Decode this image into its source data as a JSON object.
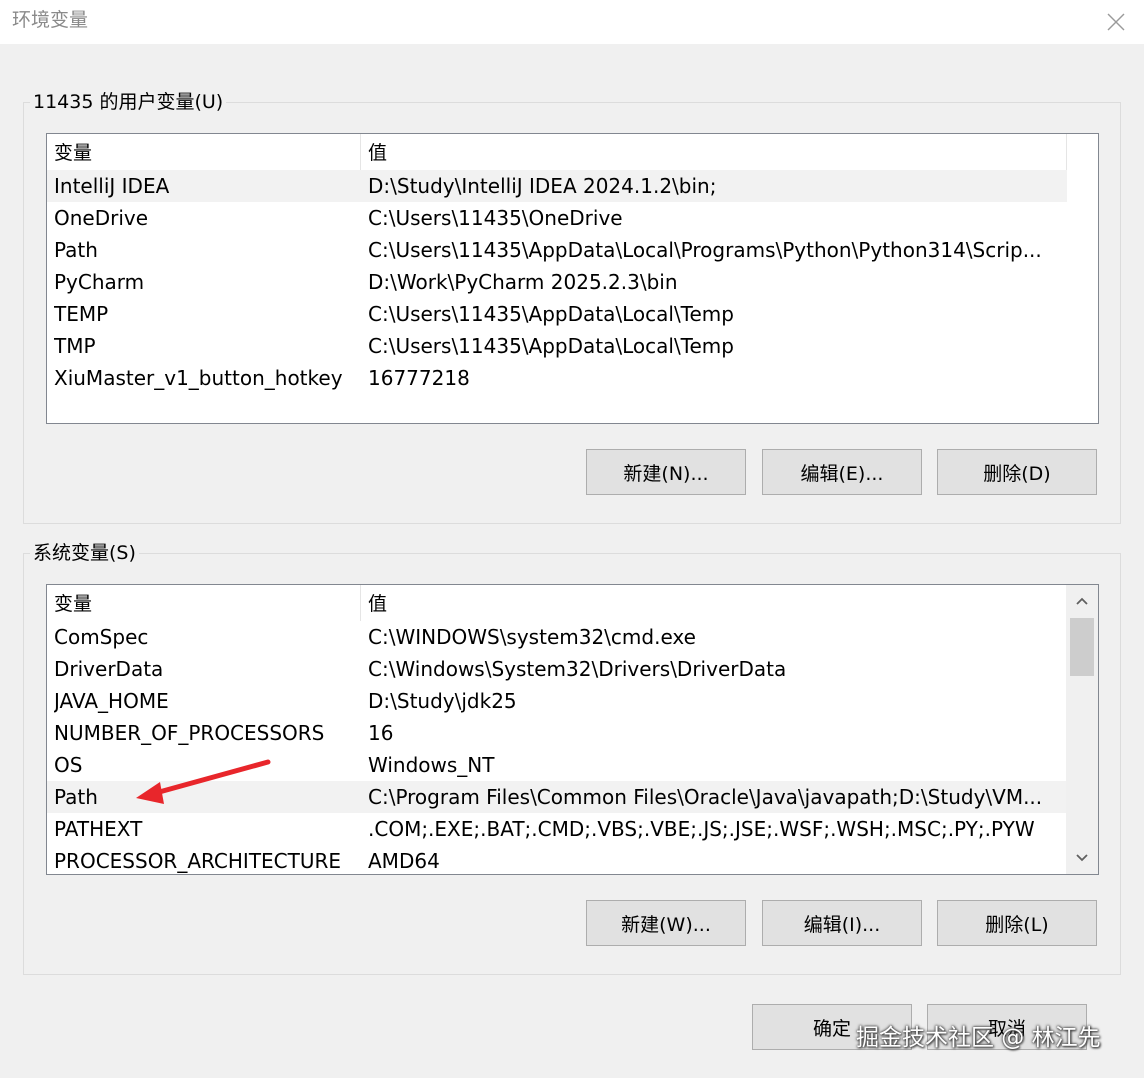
{
  "window": {
    "title": "环境变量",
    "close_label": "✕"
  },
  "user_vars": {
    "legend": "11435 的用户变量(U)",
    "col_name": "变量",
    "col_value": "值",
    "rows": [
      {
        "name": "IntelliJ IDEA",
        "value": "D:\\Study\\IntelliJ IDEA 2024.1.2\\bin;"
      },
      {
        "name": "OneDrive",
        "value": "C:\\Users\\11435\\OneDrive"
      },
      {
        "name": "Path",
        "value": "C:\\Users\\11435\\AppData\\Local\\Programs\\Python\\Python314\\Scrip..."
      },
      {
        "name": "PyCharm",
        "value": "D:\\Work\\PyCharm 2025.2.3\\bin"
      },
      {
        "name": "TEMP",
        "value": "C:\\Users\\11435\\AppData\\Local\\Temp"
      },
      {
        "name": "TMP",
        "value": "C:\\Users\\11435\\AppData\\Local\\Temp"
      },
      {
        "name": "XiuMaster_v1_button_hotkey",
        "value": "16777218"
      }
    ],
    "selected_index": 0,
    "buttons": {
      "new": "新建(N)...",
      "edit": "编辑(E)...",
      "delete": "删除(D)"
    }
  },
  "system_vars": {
    "legend": "系统变量(S)",
    "col_name": "变量",
    "col_value": "值",
    "rows": [
      {
        "name": "ComSpec",
        "value": "C:\\WINDOWS\\system32\\cmd.exe"
      },
      {
        "name": "DriverData",
        "value": "C:\\Windows\\System32\\Drivers\\DriverData"
      },
      {
        "name": "JAVA_HOME",
        "value": "D:\\Study\\jdk25"
      },
      {
        "name": "NUMBER_OF_PROCESSORS",
        "value": "16"
      },
      {
        "name": "OS",
        "value": "Windows_NT"
      },
      {
        "name": "Path",
        "value": "C:\\Program Files\\Common Files\\Oracle\\Java\\javapath;D:\\Study\\VM..."
      },
      {
        "name": "PATHEXT",
        "value": ".COM;.EXE;.BAT;.CMD;.VBS;.VBE;.JS;.JSE;.WSF;.WSH;.MSC;.PY;.PYW"
      },
      {
        "name": "PROCESSOR_ARCHITECTURE",
        "value": "AMD64"
      }
    ],
    "selected_index": 5,
    "buttons": {
      "new": "新建(W)...",
      "edit": "编辑(I)...",
      "delete": "删除(L)"
    }
  },
  "footer": {
    "ok": "确定",
    "cancel": "取消"
  },
  "watermark": "掘金技术社区 @ 林江先",
  "colors": {
    "annotation_arrow": "#e8262b",
    "selected_row": "#f2f2f2",
    "button_face": "#e1e1e1"
  }
}
